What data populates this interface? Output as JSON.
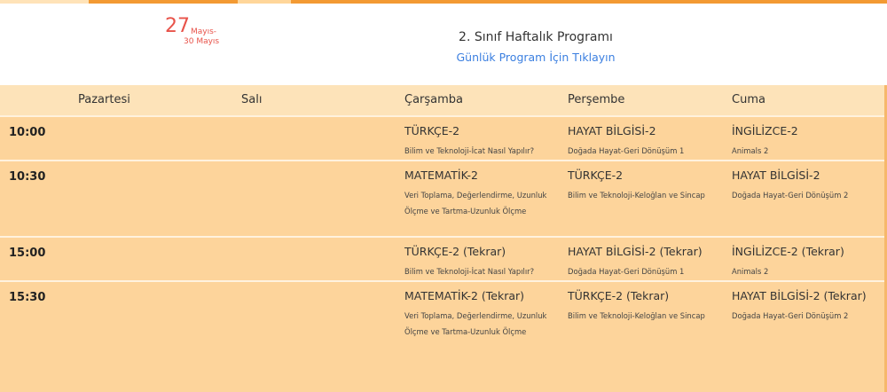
{
  "header": {
    "date_day": "27",
    "date_month1": "Mayıs-",
    "date_line2": "30 Mayıs",
    "title": "2. Sınıf Haftalık Programı",
    "daily_link": "Günlük Program İçin Tıklayın"
  },
  "days": [
    "Pazartesi",
    "Salı",
    "Çarşamba",
    "Perşembe",
    "Cuma"
  ],
  "rows": [
    {
      "time": "10:00",
      "carsamba": {
        "title": "TÜRKÇE-2",
        "desc": "Bilim ve Teknoloji-İcat Nasıl Yapılır?"
      },
      "persembe": {
        "title": "HAYAT BİLGİSİ-2",
        "desc": "Doğada Hayat-Geri Dönüşüm 1"
      },
      "cuma": {
        "title": "İNGİLİZCE-2",
        "desc": "Animals 2"
      }
    },
    {
      "time": "10:30",
      "carsamba": {
        "title": "MATEMATİK-2",
        "desc": "Veri Toplama, Değerlendirme, Uzunluk Ölçme ve Tartma-Uzunluk Ölçme"
      },
      "persembe": {
        "title": "TÜRKÇE-2",
        "desc": "Bilim ve Teknoloji-Keloğlan ve Sincap"
      },
      "cuma": {
        "title": "HAYAT BİLGİSİ-2",
        "desc": "Doğada Hayat-Geri Dönüşüm 2"
      }
    },
    {
      "time": "15:00",
      "carsamba": {
        "title": "TÜRKÇE-2 (Tekrar)",
        "desc": "Bilim ve Teknoloji-İcat Nasıl Yapılır?"
      },
      "persembe": {
        "title": "HAYAT BİLGİSİ-2 (Tekrar)",
        "desc": "Doğada Hayat-Geri Dönüşüm 1"
      },
      "cuma": {
        "title": "İNGİLİZCE-2 (Tekrar)",
        "desc": "Animals 2"
      }
    },
    {
      "time": "15:30",
      "carsamba": {
        "title": "MATEMATİK-2 (Tekrar)",
        "desc": "Veri Toplama, Değerlendirme, Uzunluk Ölçme ve Tartma-Uzunluk Ölçme"
      },
      "persembe": {
        "title": "TÜRKÇE-2 (Tekrar)",
        "desc": "Bilim ve Teknoloji-Keloğlan ve Sincap"
      },
      "cuma": {
        "title": "HAYAT BİLGİSİ-2 (Tekrar)",
        "desc": "Doğada Hayat-Geri Dönüşüm 2"
      }
    }
  ],
  "colors": {
    "accent_orange": "#f39a33",
    "date_red": "#e8534a",
    "link_blue": "#3b7fe0",
    "row_bg": "#fdd49b",
    "head_bg": "#fde3b9"
  }
}
